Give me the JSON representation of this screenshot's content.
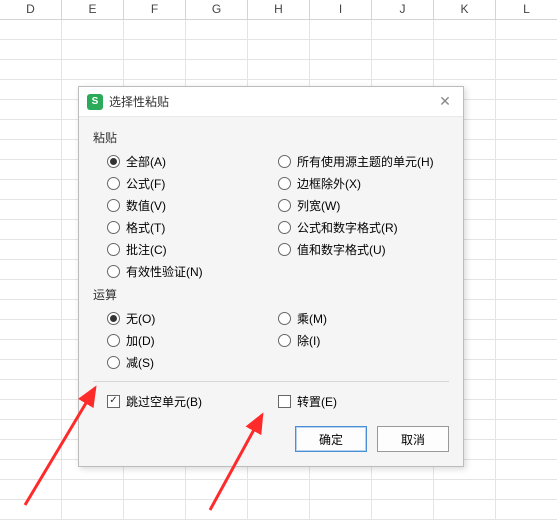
{
  "columns": [
    "D",
    "E",
    "F",
    "G",
    "H",
    "I",
    "J",
    "K",
    "L"
  ],
  "dialog": {
    "icon_letter": "S",
    "title": "选择性粘贴",
    "paste_section": "粘贴",
    "paste_options_left": [
      {
        "label": "全部(A)",
        "selected": true
      },
      {
        "label": "公式(F)",
        "selected": false
      },
      {
        "label": "数值(V)",
        "selected": false
      },
      {
        "label": "格式(T)",
        "selected": false
      },
      {
        "label": "批注(C)",
        "selected": false
      },
      {
        "label": "有效性验证(N)",
        "selected": false
      }
    ],
    "paste_options_right": [
      {
        "label": "所有使用源主题的单元(H)",
        "selected": false
      },
      {
        "label": "边框除外(X)",
        "selected": false
      },
      {
        "label": "列宽(W)",
        "selected": false
      },
      {
        "label": "公式和数字格式(R)",
        "selected": false
      },
      {
        "label": "值和数字格式(U)",
        "selected": false
      }
    ],
    "operation_section": "运算",
    "op_options_left": [
      {
        "label": "无(O)",
        "selected": true
      },
      {
        "label": "加(D)",
        "selected": false
      },
      {
        "label": "减(S)",
        "selected": false
      }
    ],
    "op_options_right": [
      {
        "label": "乘(M)",
        "selected": false
      },
      {
        "label": "除(I)",
        "selected": false
      }
    ],
    "skip_blanks": {
      "label": "跳过空单元(B)",
      "checked": true
    },
    "transpose": {
      "label": "转置(E)",
      "checked": false
    },
    "ok": "确定",
    "cancel": "取消"
  }
}
